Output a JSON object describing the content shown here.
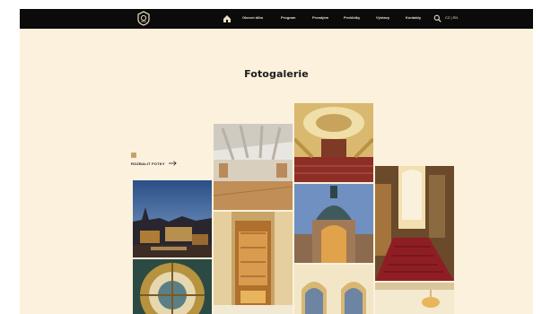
{
  "nav": {
    "items": [
      "Obecní dům",
      "Program",
      "Pronájem",
      "Prohlídky",
      "Výstavy",
      "Kontakty"
    ],
    "lang": "CZ | EN"
  },
  "page": {
    "title": "Fotogalerie"
  },
  "gallery": {
    "more_label": "ROZBALIT FOTKY",
    "photos": [
      "hall-ballroom",
      "smetana-hall",
      "prague-night-skyline",
      "elevator-interior",
      "building-facade-dome",
      "grand-staircase",
      "ceiling-dome",
      "arched-hall",
      "chandelier-room"
    ]
  },
  "colors": {
    "page_bg": "#fbf1dc",
    "topbar_bg": "#0b0b0b",
    "accent_gold": "#c4a26a"
  }
}
